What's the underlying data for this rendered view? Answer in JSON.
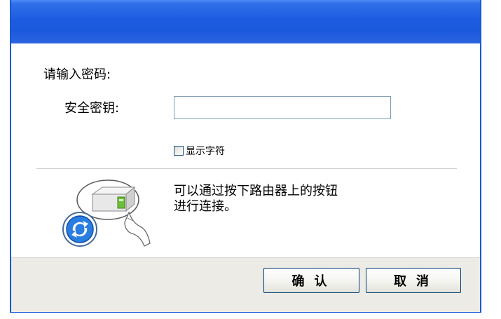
{
  "dialog": {
    "prompt": "请输入密码:",
    "key_label": "安全密钥:",
    "key_value": "",
    "show_chars_label": "显示字符",
    "show_chars_checked": false,
    "wps_line1": "可以通过按下路由器上的按钮",
    "wps_line2": "进行连接。",
    "ok_label": "确认",
    "cancel_label": "取消"
  },
  "colors": {
    "titlebar": "#1d5ce0",
    "footer": "#ecebe6",
    "button_border": "#003c74"
  },
  "icons": {
    "wps": "wps-router-push-button-icon"
  }
}
